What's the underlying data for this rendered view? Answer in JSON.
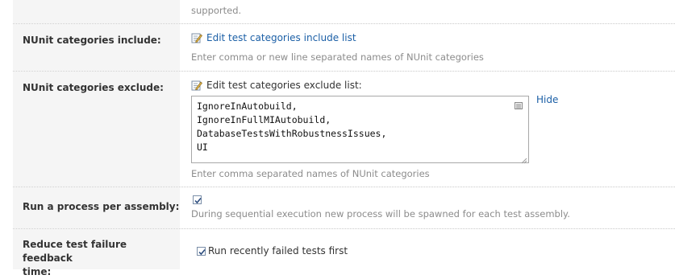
{
  "top_row": {
    "hint_tail": "supported."
  },
  "categories_include": {
    "label": "NUnit categories include:",
    "edit_link": "Edit test categories include list",
    "hint": "Enter comma or new line separated names of NUnit categories"
  },
  "categories_exclude": {
    "label": "NUnit categories exclude:",
    "edit_label": "Edit test categories exclude list:",
    "textarea_value": "IgnoreInAutobuild,\nIgnoreInFullMIAutobuild,\nDatabaseTestsWithRobustnessIssues,\nUI",
    "hide_link": "Hide",
    "hint": "Enter comma separated names of NUnit categories"
  },
  "process_per_assembly": {
    "label": "Run a process per assembly:",
    "checked": true,
    "hint": "During sequential execution new process will be spawned for each test assembly."
  },
  "reduce_feedback": {
    "label_line1": "Reduce test failure feedback",
    "label_line2": "time:",
    "checked": true,
    "checkbox_label": "Run recently failed tests first"
  },
  "colors": {
    "link": "#1b5fa6",
    "label_bg": "#f5f5f5",
    "hint": "#8c8c8c"
  },
  "icons": {
    "edit": "edit-pencil-icon",
    "expand": "expand-editor-icon",
    "check": "checkmark-icon"
  }
}
